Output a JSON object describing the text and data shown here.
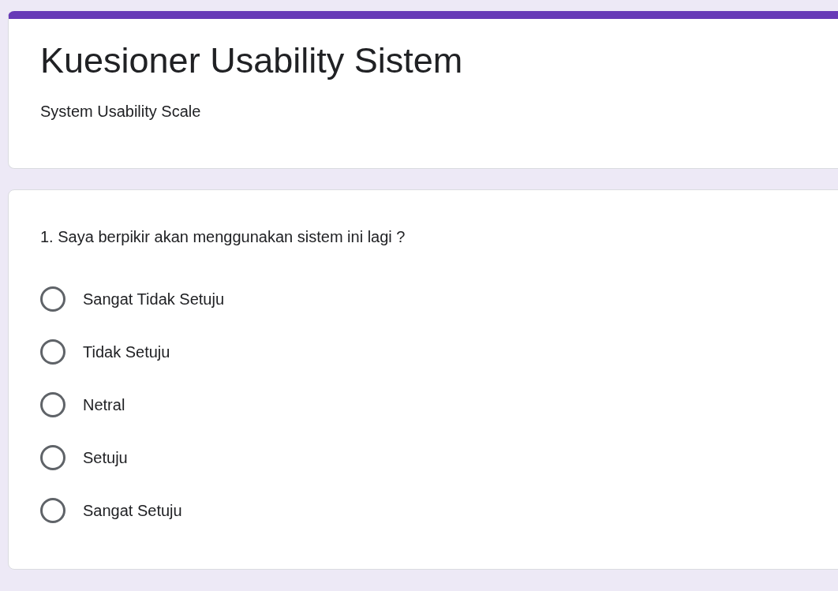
{
  "form": {
    "title": "Kuesioner Usability Sistem",
    "description": "System Usability Scale"
  },
  "question": {
    "text": "1. Saya berpikir akan menggunakan sistem ini lagi ?",
    "options": [
      {
        "label": "Sangat Tidak Setuju",
        "selected": false
      },
      {
        "label": "Tidak Setuju",
        "selected": false
      },
      {
        "label": "Netral",
        "selected": false
      },
      {
        "label": "Setuju",
        "selected": false
      },
      {
        "label": "Sangat Setuju",
        "selected": false
      }
    ]
  }
}
